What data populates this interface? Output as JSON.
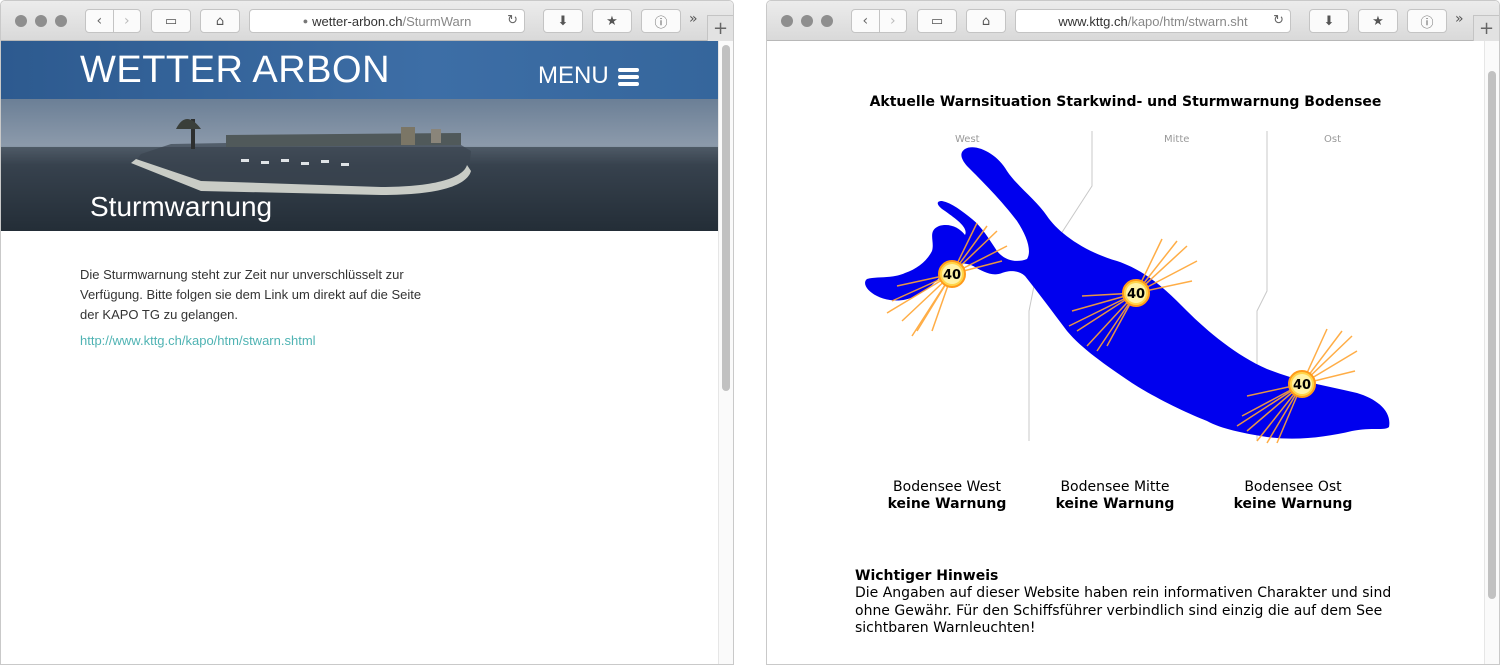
{
  "left_window": {
    "url_domain": "wetter-arbon.ch",
    "url_path": "/SturmWarn",
    "site": {
      "title": "WETTER ARBON",
      "menu_label": "MENU",
      "page_heading": "Sturmwarnung",
      "body_text": "Die Sturmwarnung steht zur Zeit nur unverschlüsselt zur Verfügung. Bitte folgen sie dem Link um direkt auf die Seite der KAPO TG zu gelangen.",
      "link_text": "http://www.kttg.ch/kapo/htm/stwarn.shtml"
    }
  },
  "right_window": {
    "url_domain": "www.kttg.ch",
    "url_path": "/kapo/htm/stwarn.sht",
    "page": {
      "title": "Aktuelle Warnsituation Starkwind- und Sturmwarnung Bodensee",
      "region_labels": [
        "West",
        "Mitte",
        "Ost"
      ],
      "warning_light_value": "40",
      "regions": [
        {
          "name": "Bodensee West",
          "status": "keine Warnung"
        },
        {
          "name": "Bodensee Mitte",
          "status": "keine Warnung"
        },
        {
          "name": "Bodensee Ost",
          "status": "keine Warnung"
        }
      ],
      "notice_title": "Wichtiger Hinweis",
      "notice_body": "Die Angaben auf dieser Website haben rein informativen Charakter und sind ohne Gewähr. Für den Schiffsführer verbindlich sind einzig die auf dem See sichtbaren Warnleuchten!"
    }
  },
  "toolbar": {
    "back_icon": "‹",
    "forward_icon": "›",
    "sidebar_icon": "▭",
    "home_icon": "⌂",
    "lock_icon": "🔒",
    "reload_icon": "↻",
    "download_icon": "⬇",
    "bookmark_icon": "★",
    "info_icon": "ⓘ",
    "more_icon": "»",
    "new_tab_icon": "+"
  },
  "colors": {
    "lake": "#0000ee",
    "banner_blue": "#3d6ea6",
    "link": "#4fb3b3",
    "warning_ray": "#ffa533"
  }
}
